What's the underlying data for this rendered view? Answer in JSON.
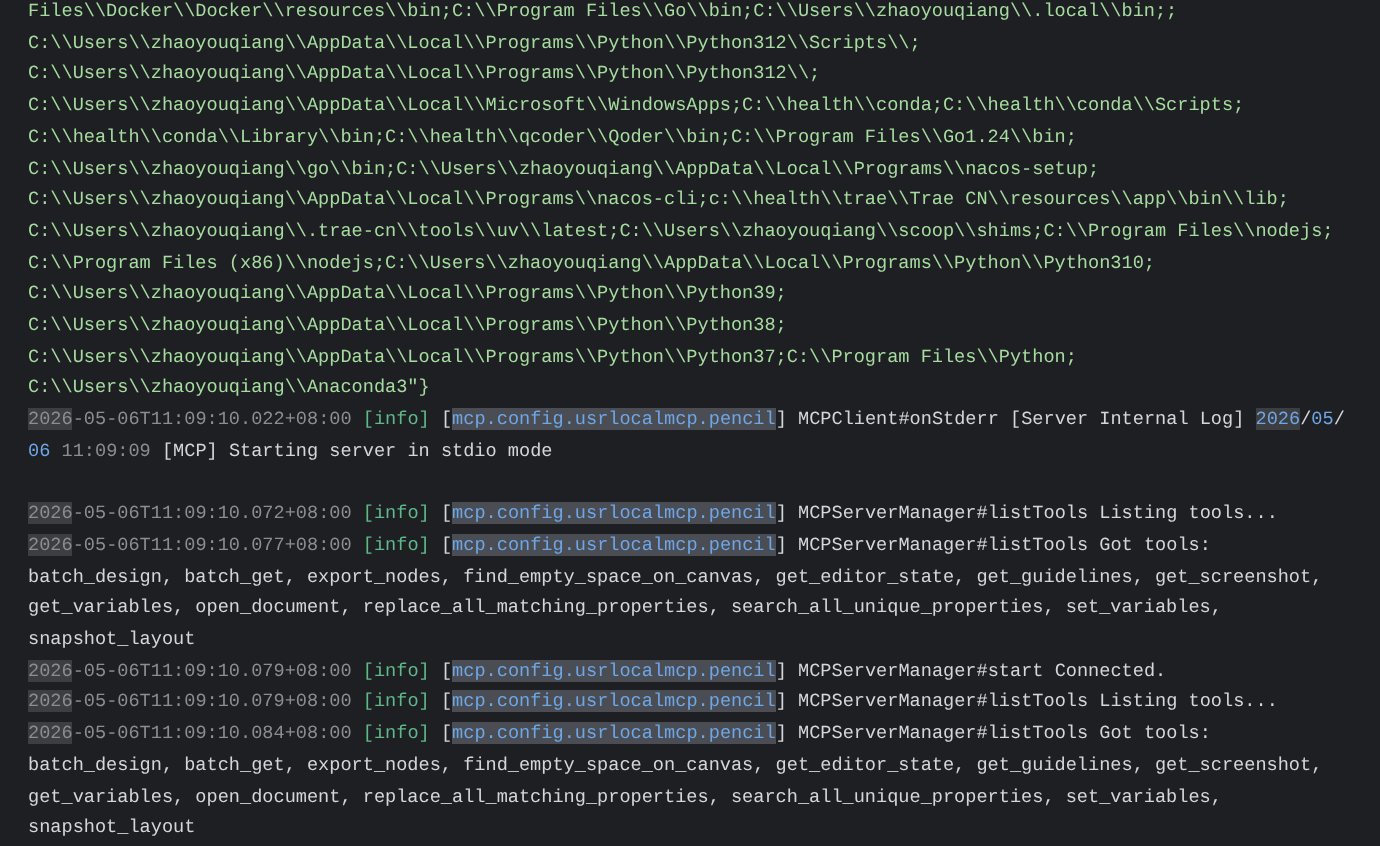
{
  "path_lines": [
    "Files\\\\Docker\\\\Docker\\\\resources\\\\bin;C:\\\\Program Files\\\\Go\\\\bin;C:\\\\Users\\\\zhaoyouqiang\\\\.local\\\\bin;;",
    "C:\\\\Users\\\\zhaoyouqiang\\\\AppData\\\\Local\\\\Programs\\\\Python\\\\Python312\\\\Scripts\\\\;",
    "C:\\\\Users\\\\zhaoyouqiang\\\\AppData\\\\Local\\\\Programs\\\\Python\\\\Python312\\\\;",
    "C:\\\\Users\\\\zhaoyouqiang\\\\AppData\\\\Local\\\\Microsoft\\\\WindowsApps;C:\\\\health\\\\conda;C:\\\\health\\\\conda\\\\Scripts;",
    "C:\\\\health\\\\conda\\\\Library\\\\bin;C:\\\\health\\\\qcoder\\\\Qoder\\\\bin;C:\\\\Program Files\\\\Go1.24\\\\bin;",
    "C:\\\\Users\\\\zhaoyouqiang\\\\go\\\\bin;C:\\\\Users\\\\zhaoyouqiang\\\\AppData\\\\Local\\\\Programs\\\\nacos-setup;",
    "C:\\\\Users\\\\zhaoyouqiang\\\\AppData\\\\Local\\\\Programs\\\\nacos-cli;c:\\\\health\\\\trae\\\\Trae CN\\\\resources\\\\app\\\\bin\\\\lib;",
    "C:\\\\Users\\\\zhaoyouqiang\\\\.trae-cn\\\\tools\\\\uv\\\\latest;C:\\\\Users\\\\zhaoyouqiang\\\\scoop\\\\shims;C:\\\\Program Files\\\\nodejs;",
    "C:\\\\Program Files (x86)\\\\nodejs;C:\\\\Users\\\\zhaoyouqiang\\\\AppData\\\\Local\\\\Programs\\\\Python\\\\Python310;",
    "C:\\\\Users\\\\zhaoyouqiang\\\\AppData\\\\Local\\\\Programs\\\\Python\\\\Python39;",
    "C:\\\\Users\\\\zhaoyouqiang\\\\AppData\\\\Local\\\\Programs\\\\Python\\\\Python38;",
    "C:\\\\Users\\\\zhaoyouqiang\\\\AppData\\\\Local\\\\Programs\\\\Python\\\\Python37;C:\\\\Program Files\\\\Python;",
    "C:\\\\Users\\\\zhaoyouqiang\\\\Anaconda3\"}"
  ],
  "entries": [
    {
      "kind": "log",
      "segments": [
        {
          "kind": "match",
          "text": "2026"
        },
        {
          "kind": "timestamp",
          "text": "-05-06T11:09:10.022+08:00 "
        },
        {
          "kind": "level",
          "text": "[info]"
        },
        {
          "kind": "text",
          "text": " ["
        },
        {
          "kind": "source",
          "text": "mcp.config.usrlocalmcp.pencil"
        },
        {
          "kind": "text",
          "text": "] MCPClient#onStderr [Server Internal Log] "
        },
        {
          "kind": "match_number",
          "text": "2026"
        },
        {
          "kind": "text",
          "text": "/"
        },
        {
          "kind": "number",
          "text": "05"
        },
        {
          "kind": "text",
          "text": "/\n"
        },
        {
          "kind": "number",
          "text": "06"
        },
        {
          "kind": "timestamp",
          "text": " 11:09:09"
        },
        {
          "kind": "text",
          "text": " [MCP] Starting server in stdio mode"
        }
      ]
    },
    {
      "kind": "spacer"
    },
    {
      "kind": "log",
      "segments": [
        {
          "kind": "match",
          "text": "2026"
        },
        {
          "kind": "timestamp",
          "text": "-05-06T11:09:10.072+08:00 "
        },
        {
          "kind": "level",
          "text": "[info]"
        },
        {
          "kind": "text",
          "text": " ["
        },
        {
          "kind": "source",
          "text": "mcp.config.usrlocalmcp.pencil"
        },
        {
          "kind": "text",
          "text": "] MCPServerManager#listTools Listing tools..."
        }
      ]
    },
    {
      "kind": "log",
      "segments": [
        {
          "kind": "match",
          "text": "2026"
        },
        {
          "kind": "timestamp",
          "text": "-05-06T11:09:10.077+08:00 "
        },
        {
          "kind": "level",
          "text": "[info]"
        },
        {
          "kind": "text",
          "text": " ["
        },
        {
          "kind": "source",
          "text": "mcp.config.usrlocalmcp.pencil"
        },
        {
          "kind": "text",
          "text": "] MCPServerManager#listTools Got tools:\nbatch_design, batch_get, export_nodes, find_empty_space_on_canvas, get_editor_state, get_guidelines, get_screenshot,\nget_variables, open_document, replace_all_matching_properties, search_all_unique_properties, set_variables,\nsnapshot_layout"
        }
      ]
    },
    {
      "kind": "log",
      "segments": [
        {
          "kind": "match",
          "text": "2026"
        },
        {
          "kind": "timestamp",
          "text": "-05-06T11:09:10.079+08:00 "
        },
        {
          "kind": "level",
          "text": "[info]"
        },
        {
          "kind": "text",
          "text": " ["
        },
        {
          "kind": "source",
          "text": "mcp.config.usrlocalmcp.pencil"
        },
        {
          "kind": "text",
          "text": "] MCPServerManager#start Connected."
        }
      ]
    },
    {
      "kind": "log",
      "segments": [
        {
          "kind": "match",
          "text": "2026"
        },
        {
          "kind": "timestamp",
          "text": "-05-06T11:09:10.079+08:00 "
        },
        {
          "kind": "level",
          "text": "[info]"
        },
        {
          "kind": "text",
          "text": " ["
        },
        {
          "kind": "source",
          "text": "mcp.config.usrlocalmcp.pencil"
        },
        {
          "kind": "text",
          "text": "] MCPServerManager#listTools Listing tools..."
        }
      ]
    },
    {
      "kind": "log",
      "segments": [
        {
          "kind": "match",
          "text": "2026"
        },
        {
          "kind": "timestamp",
          "text": "-05-06T11:09:10.084+08:00 "
        },
        {
          "kind": "level",
          "text": "[info]"
        },
        {
          "kind": "text",
          "text": " ["
        },
        {
          "kind": "source",
          "text": "mcp.config.usrlocalmcp.pencil"
        },
        {
          "kind": "text",
          "text": "] MCPServerManager#listTools Got tools:\nbatch_design, batch_get, export_nodes, find_empty_space_on_canvas, get_editor_state, get_guidelines, get_screenshot,\nget_variables, open_document, replace_all_matching_properties, search_all_unique_properties, set_variables,\nsnapshot_layout"
        }
      ]
    }
  ]
}
